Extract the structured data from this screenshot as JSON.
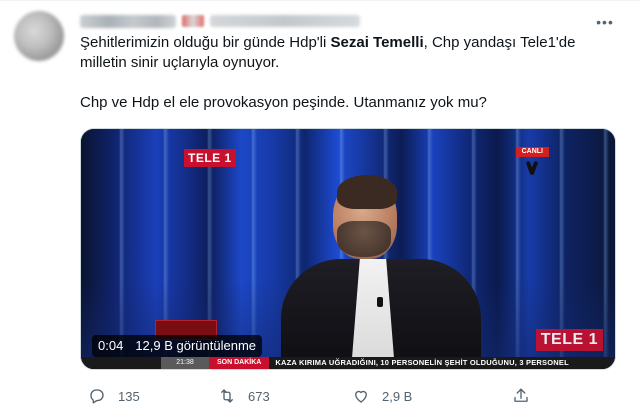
{
  "tweet": {
    "paragraph1": {
      "before": "Şehitlerimizin olduğu bir günde Hdp'li ",
      "bold": "Sezai Temelli",
      "after": ", Chp yandaşı Tele1'de milletin sinir uçlarıyla oynuyor."
    },
    "paragraph2": "Chp ve Hdp el ele provokasyon peşinde. Utanmanız yok mu?"
  },
  "video": {
    "channel_logo_top": "TELE 1",
    "channel_logo_bottom": "TELE 1",
    "live_label": "CANLI",
    "time": "0:04",
    "views": "12,9 B görüntülenme",
    "ticker_clock": "21:38",
    "ticker_label": "SON DAKİKA",
    "ticker_text": "KAZA KIRIMA UĞRADIĞINI, 10 PERSONELİN ŞEHİT OLDUĞUNU, 3 PERSONEL"
  },
  "actions": {
    "reply_count": "135",
    "retweet_count": "673",
    "like_count": "2,9 B"
  },
  "icons": {
    "more": "more-dots-icon",
    "reply": "reply-icon",
    "retweet": "retweet-icon",
    "like": "heart-icon",
    "share": "share-icon"
  },
  "colors": {
    "text_primary": "#0f1419",
    "text_secondary": "#536471",
    "brand_red": "#c8102e"
  }
}
